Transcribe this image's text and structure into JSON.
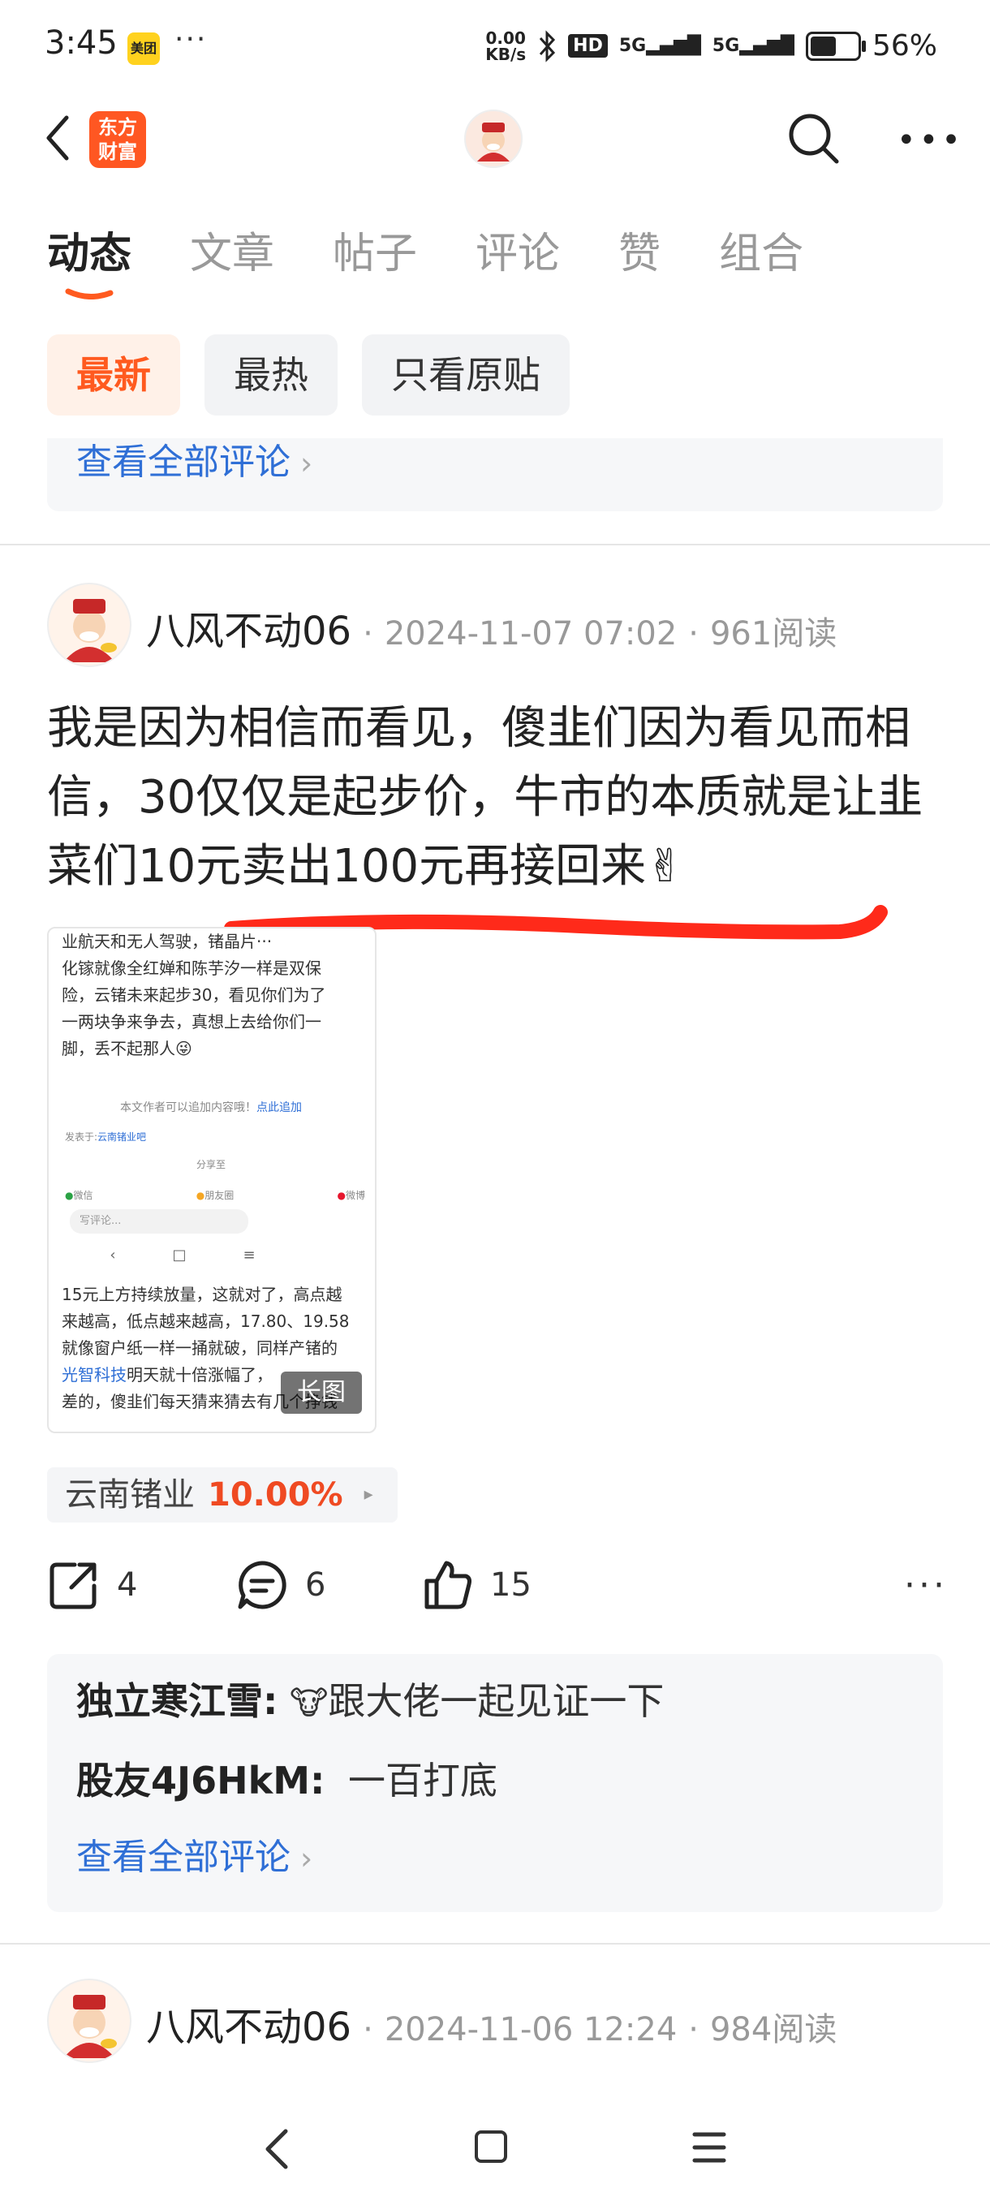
{
  "status_bar": {
    "time": "3:45",
    "meituan_badge": "美团",
    "dots": "···",
    "net_speed_value": "0.00",
    "net_speed_unit": "KB/s",
    "hd_label": "HD",
    "signal_1": "5G",
    "signal_2": "5G",
    "battery_percent": "56%",
    "battery_level": 0.56
  },
  "header": {
    "logo_line1": "东方",
    "logo_line2": "财富"
  },
  "tabs": [
    "动态",
    "文章",
    "帖子",
    "评论",
    "赞",
    "组合"
  ],
  "filters": [
    "最新",
    "最热",
    "只看原贴"
  ],
  "prev_card": {
    "view_all": "查看全部评论"
  },
  "post": {
    "author": "八风不动06",
    "sep": "·",
    "date": "2024-11-07 07:02",
    "reads": "961阅读",
    "content": "我是因为相信而看见，傻韭们因为看见而相信，30仅仅是起步价，牛市的本质就是让韭菜们10元卖出100元再接回来✌",
    "thumbnail": {
      "line1": "业航天和无人驾驶，锗晶片···",
      "line2": "化镓就像全红婵和陈芋汐一样是双保",
      "line3": "险，云锗未来起步30，看见你们为了",
      "line4": "一两块争来争去，真想上去给你们一",
      "line5": "脚，丢不起那人😜",
      "append_note": "本文作者可以追加内容哦！",
      "append_link": "点此追加",
      "posted_in_label": "发表于:",
      "posted_in": "云南锗业吧",
      "share_label": "分享至",
      "share_wechat": "微信",
      "share_moments": "朋友圈",
      "share_weibo": "微博",
      "comment_placeholder": "写评论...",
      "body1": "15元上方持续放量，这就对了，高点越",
      "body2": "来越高，低点越来越高，17.80、19.58",
      "body3": "就像窗户纸一样一捅就破，同样产锗的",
      "body4_link": "光智科技",
      "body4_rest": "明天就十倍涨幅了，",
      "body5": "差的，傻韭们每天猜来猜去有几个挣钱",
      "long_badge": "长图"
    },
    "stock": {
      "name": "云南锗业",
      "change": "10.00%",
      "arrow": "▸"
    },
    "actions": {
      "share_count": "4",
      "comment_count": "6",
      "like_count": "15",
      "more": "···"
    },
    "comments": [
      {
        "user": "独立寒江雪:",
        "text": "跟大佬一起见证一下"
      },
      {
        "user": "股友4J6HkM:",
        "text": "一百打底"
      }
    ],
    "view_all": "查看全部评论"
  },
  "next_post": {
    "author": "八风不动06",
    "sep": "·",
    "date": "2024-11-06 12:24",
    "reads": "984阅读"
  },
  "colors": {
    "accent": "#ff5a1f",
    "link": "#2f6fd6",
    "up": "#ef4a22"
  }
}
